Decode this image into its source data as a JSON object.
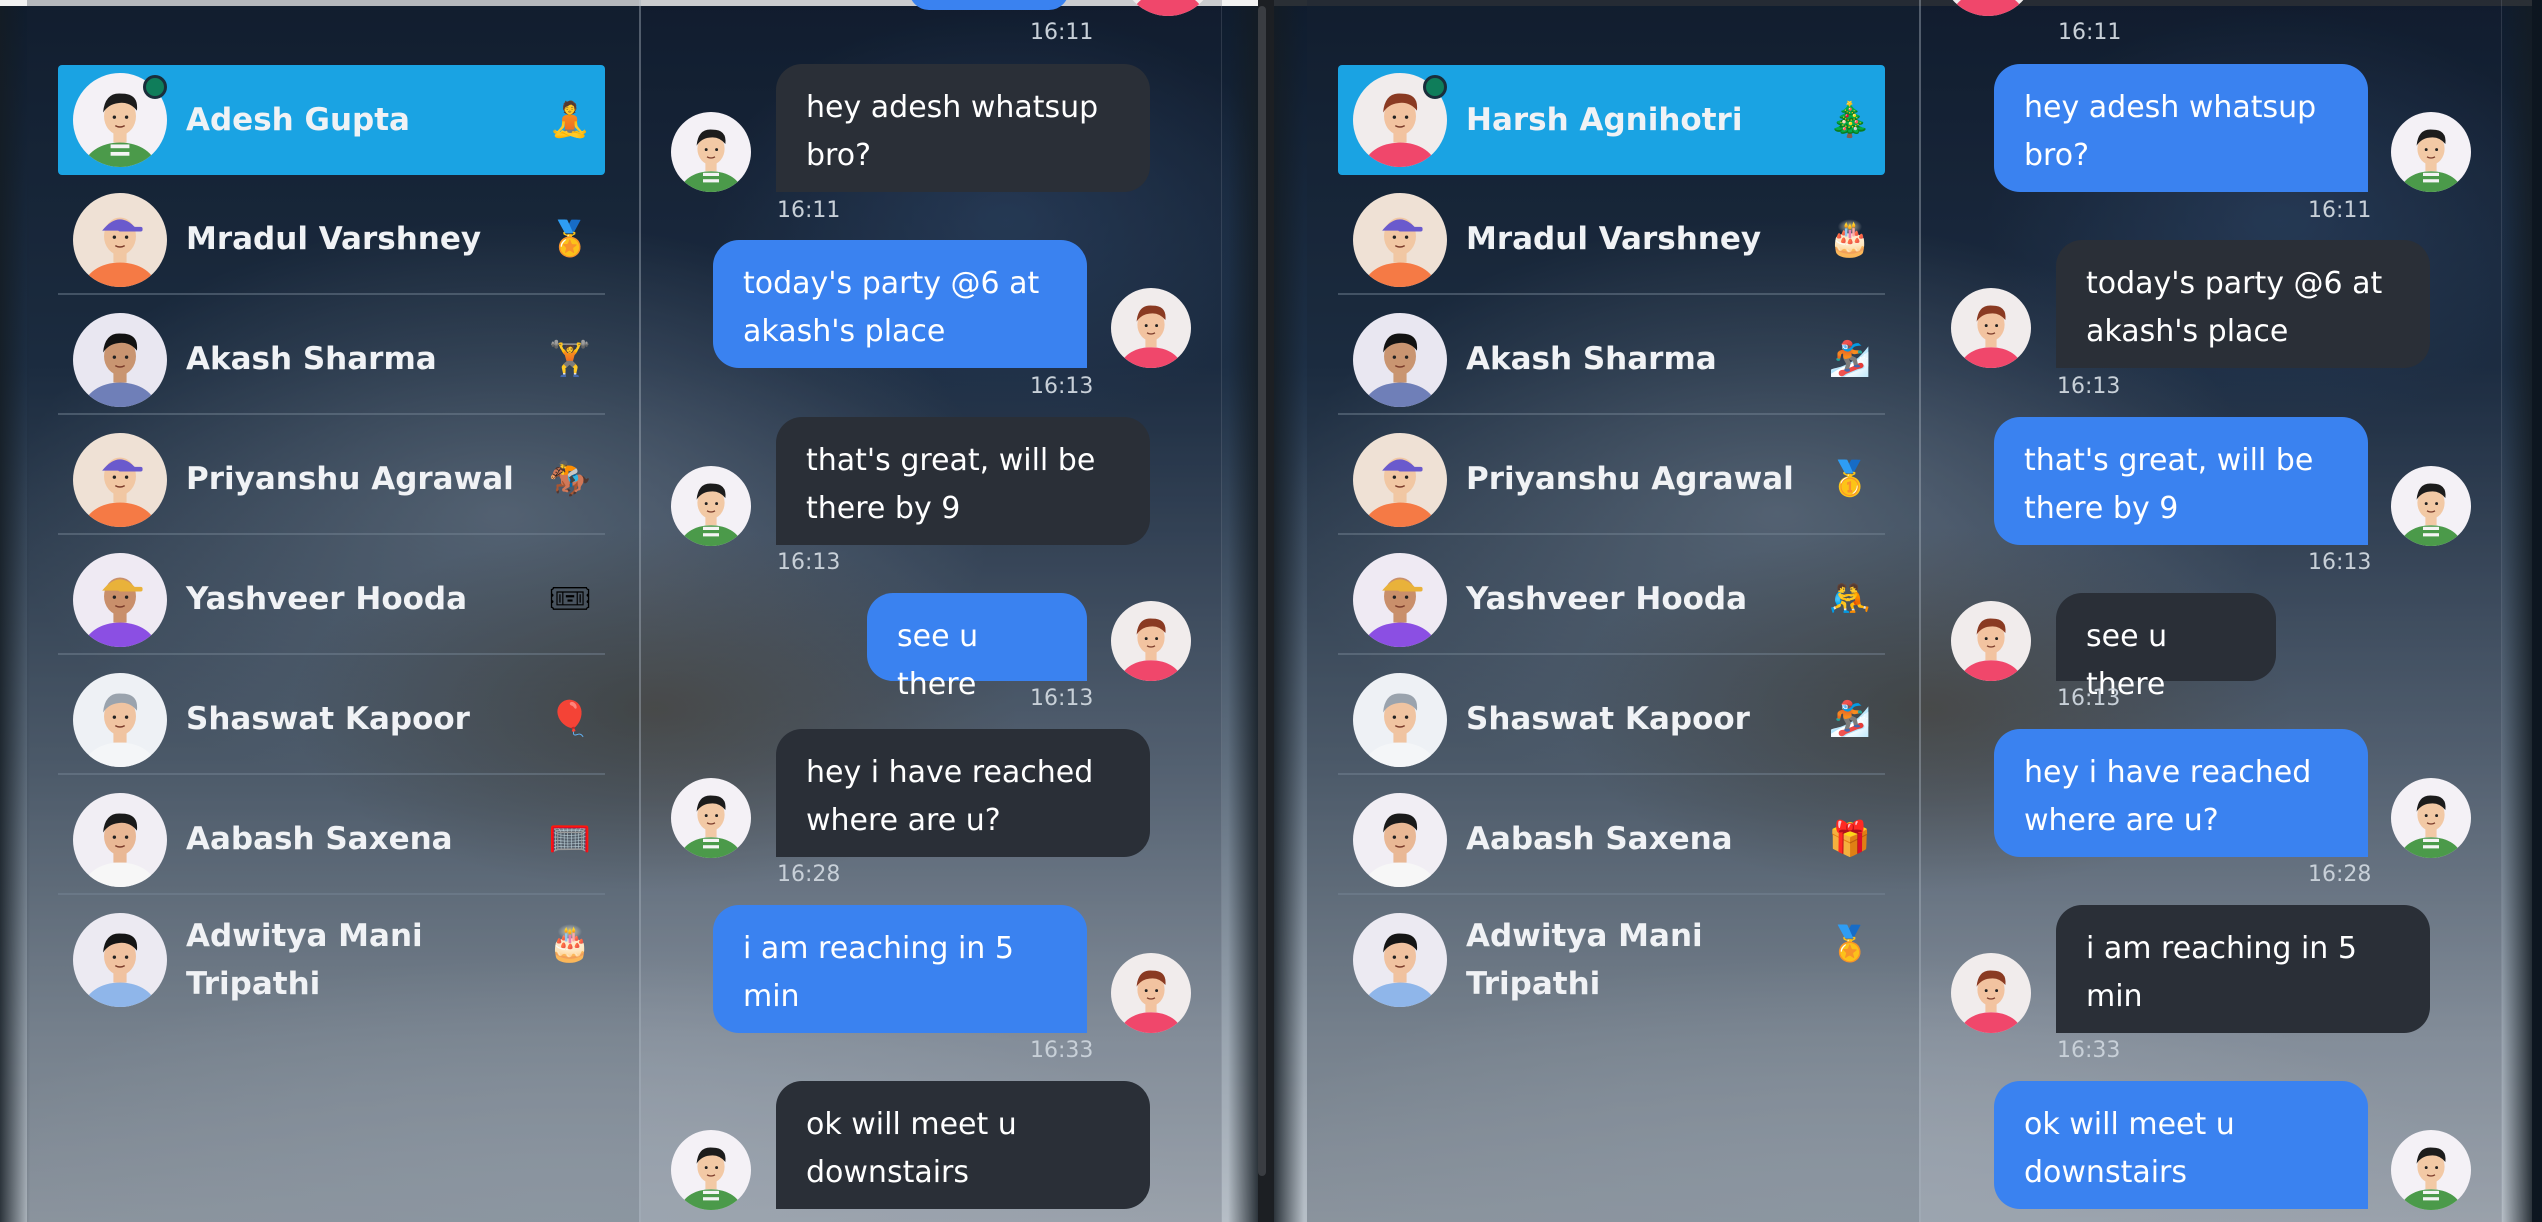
{
  "left_panel": {
    "contacts": [
      {
        "name": "Adesh Gupta",
        "emoji": "🧘",
        "active": true
      },
      {
        "name": "Mradul Varshney",
        "emoji": "🏅"
      },
      {
        "name": "Akash Sharma",
        "emoji": "🏋"
      },
      {
        "name": "Priyanshu Agrawal",
        "emoji": "🏇"
      },
      {
        "name": "Yashveer Hooda",
        "emoji": "🎟"
      },
      {
        "name": "Shaswat Kapoor",
        "emoji": "🎈"
      },
      {
        "name": "Aabash Saxena",
        "emoji": "🥅"
      },
      {
        "name": "Adwitya Mani Tripathi",
        "emoji": "🎂"
      }
    ],
    "top_time": "16:11",
    "messages": [
      {
        "text": "hey adesh whatsup bro?",
        "time": "16:11",
        "type": "dark"
      },
      {
        "text": "today's party @6 at akash's place",
        "time": "16:13",
        "type": "blue"
      },
      {
        "text": "that's great, will be there by 9",
        "time": "16:13",
        "type": "dark"
      },
      {
        "text": "see u there",
        "time": "16:13",
        "type": "blue"
      },
      {
        "text": "hey i have reached where are u?",
        "time": "16:28",
        "type": "dark"
      },
      {
        "text": "i am reaching in 5 min",
        "time": "16:33",
        "type": "blue"
      },
      {
        "text": "ok will meet u downstairs",
        "time": "",
        "type": "dark"
      }
    ]
  },
  "right_panel": {
    "contacts": [
      {
        "name": "Harsh Agnihotri",
        "emoji": "🎄",
        "active": true
      },
      {
        "name": "Mradul Varshney",
        "emoji": "🎂"
      },
      {
        "name": "Akash Sharma",
        "emoji": "🏂"
      },
      {
        "name": "Priyanshu Agrawal",
        "emoji": "🥇"
      },
      {
        "name": "Yashveer Hooda",
        "emoji": "🤼"
      },
      {
        "name": "Shaswat Kapoor",
        "emoji": "🏂"
      },
      {
        "name": "Aabash Saxena",
        "emoji": "🎁"
      },
      {
        "name": "Adwitya Mani Tripathi",
        "emoji": "🏅"
      }
    ],
    "top_time": "16:11",
    "messages": [
      {
        "text": "hey adesh whatsup bro?",
        "time": "16:11",
        "type": "blue"
      },
      {
        "text": "today's party @6 at akash's place",
        "time": "16:13",
        "type": "dark"
      },
      {
        "text": "that's great, will be there by 9",
        "time": "16:13",
        "type": "blue"
      },
      {
        "text": "see u there",
        "time": "16:13",
        "type": "dark"
      },
      {
        "text": "hey i have reached where are u?",
        "time": "16:28",
        "type": "blue"
      },
      {
        "text": "i am reaching in 5 min",
        "time": "16:33",
        "type": "dark"
      },
      {
        "text": "ok will meet u downstairs",
        "time": "",
        "type": "blue"
      }
    ]
  },
  "colors": {
    "active_contact": "#1aa3e3",
    "bubble_blue": "#3a82f0",
    "bubble_dark": "#2a2f37",
    "online_dot": "#0f7d5a"
  }
}
